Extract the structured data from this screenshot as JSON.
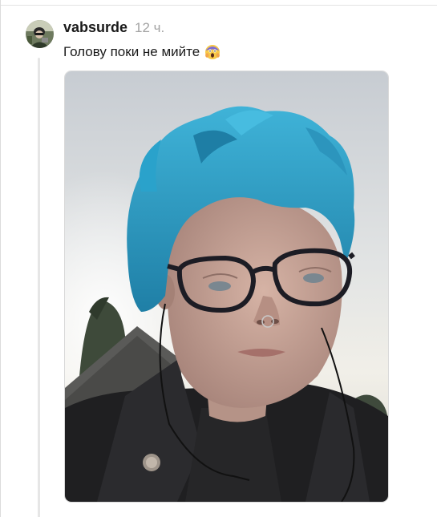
{
  "comment": {
    "author": "vabsurde",
    "time": "12 ч.",
    "text": "Голову поки не мийте",
    "emoji_icon": "face-screaming-in-fear-icon",
    "avatar_icon": "user-avatar",
    "photo_icon": "selfie-photo"
  },
  "colors": {
    "hair": "#2d9cc4",
    "text": "#1a1a1a",
    "muted": "#a3a3a3",
    "thread": "#e6e6e6"
  }
}
